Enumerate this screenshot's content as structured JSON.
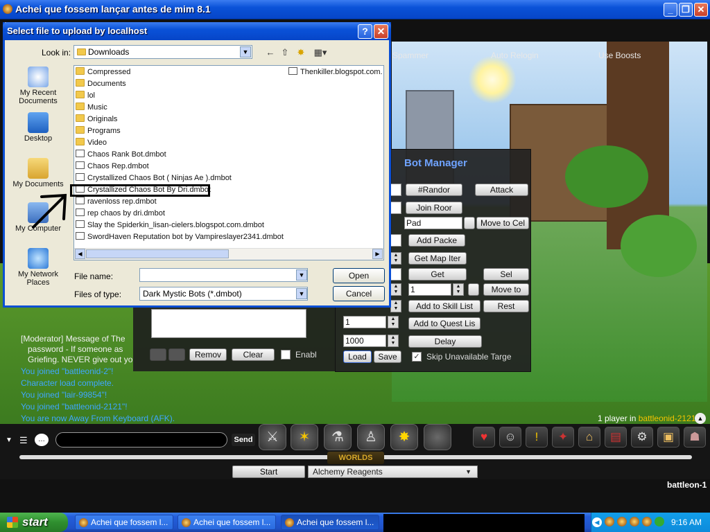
{
  "main_window": {
    "title": "Achei que fossem lançar antes de mim 8.1"
  },
  "bot_tabs": [
    "Spammer",
    "Auto Relogin",
    "Use Boosts"
  ],
  "bot_manager": {
    "title": "Bot Manager",
    "randomize": "#Randor",
    "attack": "Attack",
    "join_room": "Join Roor",
    "room_value": "Pad",
    "move_to_cell": "Move to Cel",
    "add_packet": "Add Packe",
    "get_map_item": "Get Map Iter",
    "get": "Get",
    "sel": "Sel",
    "skill_value": "1",
    "move_to": "Move to",
    "add_to_skill_list": "Add to Skill List",
    "rest": "Rest",
    "quest_value": "1",
    "add_to_quest_list": "Add to Quest Lis",
    "delay_value": "1000",
    "delay": "Delay",
    "load": "Load",
    "save": "Save",
    "skip_unavailable": "Skip Unavailable Targe",
    "remove": "Remov",
    "clear": "Clear",
    "enable": "Enabl"
  },
  "chat": {
    "moderator_lines": [
      "[Moderator] Message of The",
      "password - If someone as",
      "Griefing. NEVER give out yo"
    ],
    "lines": [
      "You joined \"battleonid-2\"!",
      "Character load complete.",
      "You joined \"lair-99854\"!",
      "You joined \"battleonid-2121\"!",
      "You are now Away From Keyboard (AFK)."
    ],
    "send": "Send"
  },
  "hud": {
    "players_prefix": "1 player in",
    "players_room": "battleonid-2121",
    "worlds": "WORLDS",
    "start": "Start",
    "quest_select": "Alchemy Reagents",
    "server": "battleon-1"
  },
  "dialog": {
    "title": "Select file to upload by localhost",
    "help": "?",
    "close": "✕",
    "look_in_label": "Look in:",
    "look_in_value": "Downloads",
    "places": [
      "My Recent Documents",
      "Desktop",
      "My Documents",
      "My Computer",
      "My Network Places"
    ],
    "folders": [
      "Compressed",
      "Documents",
      "lol",
      "Music",
      "Originals",
      "Programs",
      "Video"
    ],
    "files": [
      "Chaos Rank Bot.dmbot",
      "Chaos Rep.dmbot",
      "Crystallized Chaos Bot ( Ninjas Ae ).dmbot",
      "Crystallized Chaos Bot By Dri.dmbot",
      "ravenloss rep.dmbot",
      "rep chaos by dri.dmbot",
      "Slay the Spiderkin_lisan-cielers.blogspot.com.dmbot",
      "SwordHaven Reputation bot by Vampireslayer2341.dmbot"
    ],
    "second_column_file": "Thenkiller.blogspot.com.c",
    "file_name_label": "File name:",
    "file_name_value": "",
    "file_type_label": "Files of type:",
    "file_type_value": "Dark Mystic Bots (*.dmbot)",
    "open": "Open",
    "cancel": "Cancel"
  },
  "taskbar": {
    "start": "start",
    "tasks": [
      "Achei que fossem l...",
      "Achei que fossem l...",
      "Achei que fossem l..."
    ],
    "clock": "9:16 AM"
  }
}
